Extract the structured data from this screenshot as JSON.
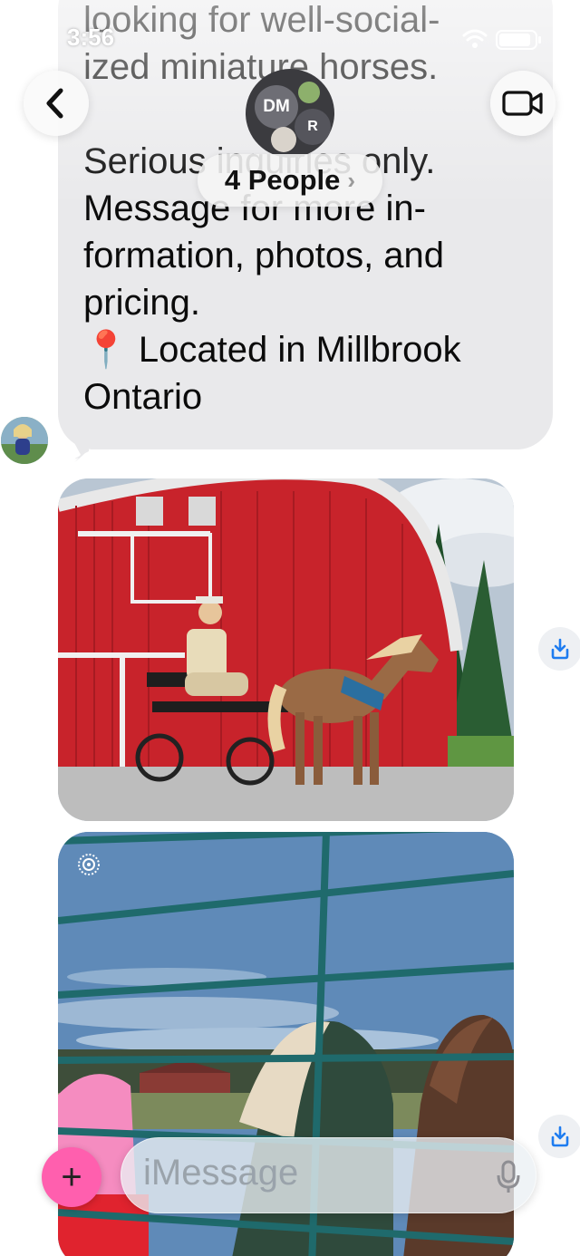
{
  "status_bar": {
    "time": "3:56"
  },
  "header": {
    "back_label": "<",
    "group_initials_primary": "DM",
    "group_initials_secondary": "R",
    "people_label": "4 People",
    "people_chevron": "›"
  },
  "message": {
    "text": "looking for well-social-\nized miniature horses.\n\nSerious inquiries only.\nMessage for more in-\nformation, photos, and\npricing.\n📍 Located in Millbrook\nOntario"
  },
  "photos": [
    {
      "description_icon": "photo-barn-horse-cart"
    },
    {
      "description_icon": "photo-horses-fence"
    }
  ],
  "composer": {
    "plus_label": "+",
    "placeholder": "iMessage"
  },
  "colors": {
    "bubble": "#e9e9eb",
    "barn_red": "#c8232b",
    "plus_button": "#ff5fae",
    "download_blue": "#1e7cf0"
  },
  "icons": {
    "back": "chevron-left-icon",
    "video": "video-camera-icon",
    "download": "download-icon",
    "mic": "microphone-icon",
    "live_photo": "live-photo-icon"
  }
}
